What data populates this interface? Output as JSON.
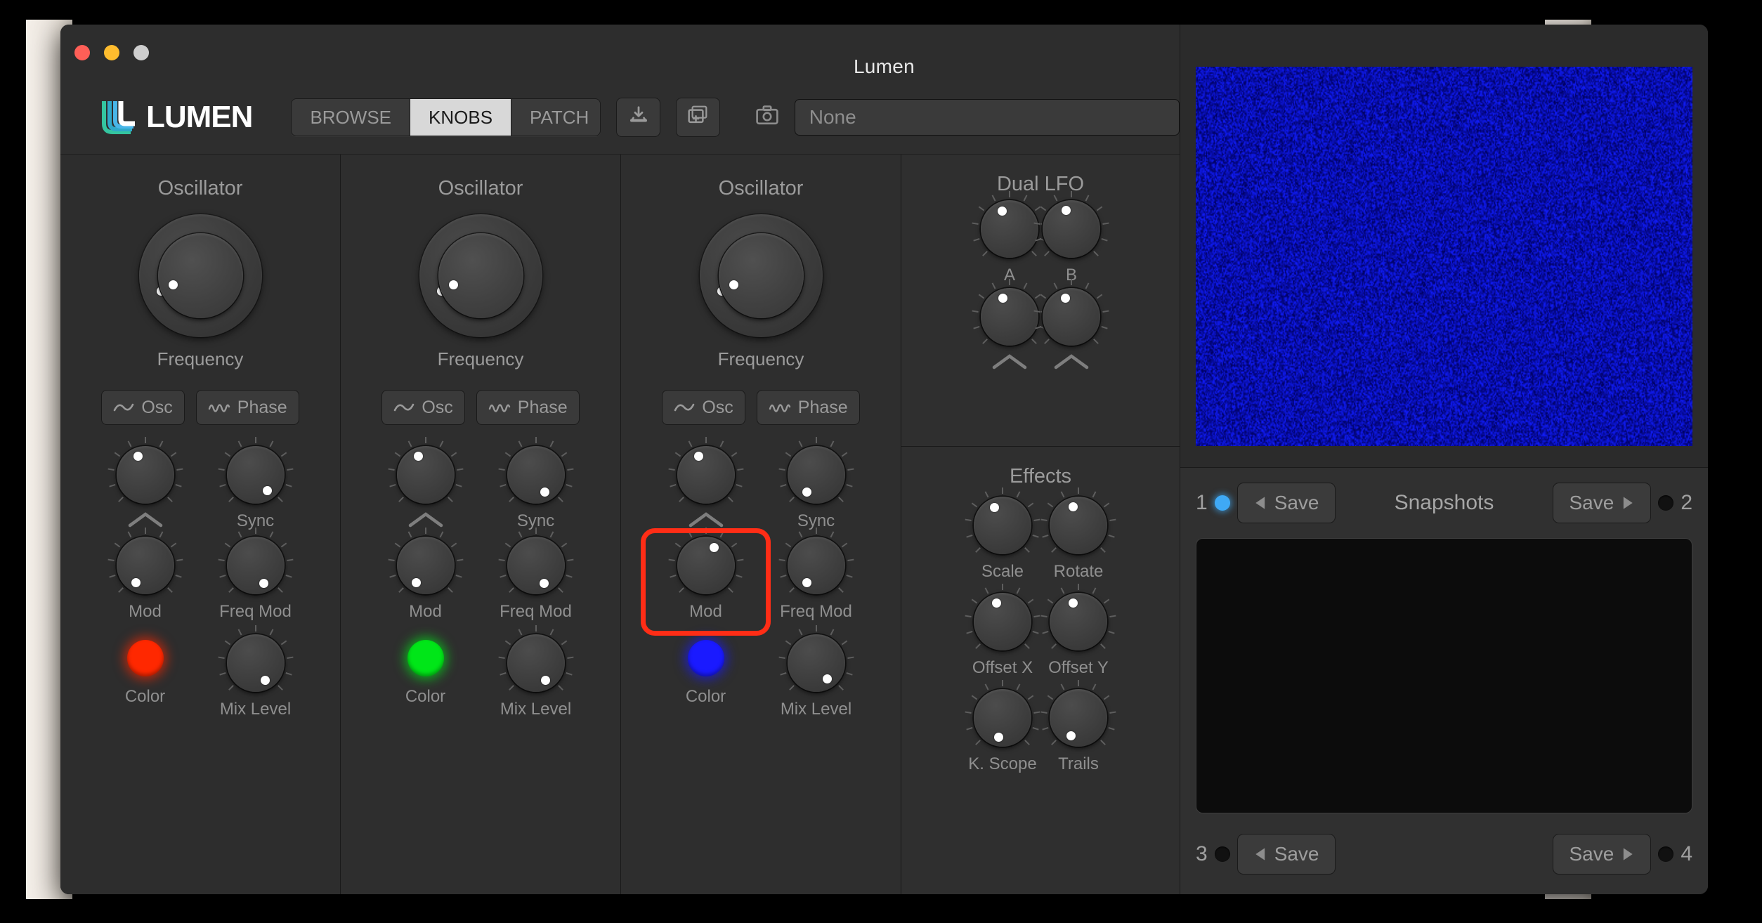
{
  "window": {
    "title": "Lumen",
    "traffic_lights": [
      "close-red",
      "minimize-yellow",
      "zoom-gray"
    ]
  },
  "toolbar": {
    "logo_text": "LUMEN",
    "tabs": [
      {
        "label": "BROWSE",
        "active": false
      },
      {
        "label": "KNOBS",
        "active": true
      },
      {
        "label": "PATCH",
        "active": false
      }
    ],
    "icon_buttons": [
      {
        "name": "download-icon",
        "glyph": "download"
      },
      {
        "name": "add-layer-icon",
        "glyph": "add-layer"
      }
    ],
    "camera_icon": "camera-icon",
    "patch_name_field": {
      "value": "None",
      "placeholder": "None"
    }
  },
  "oscillators": [
    {
      "title": "Oscillator",
      "frequency_label": "Frequency",
      "freq_outer_angle": 248,
      "freq_inner_angle": 250,
      "wave_buttons": [
        {
          "label": "Osc",
          "icon": "sine-wave-icon"
        },
        {
          "label": "Phase",
          "icon": "double-wave-icon"
        }
      ],
      "knobs": [
        {
          "label": "",
          "icon": "chevron-up-icon",
          "angle": 340,
          "name": "shape-knob"
        },
        {
          "label": "Sync",
          "angle": 143,
          "name": "sync-knob"
        },
        {
          "label": "Mod",
          "angle": 207,
          "name": "mod-knob"
        },
        {
          "label": "Freq Mod",
          "angle": 155,
          "name": "freq-mod-knob"
        }
      ],
      "color_label": "Color",
      "color": "#ff2800",
      "mix_label": "Mix Level",
      "mix_angle": 150
    },
    {
      "title": "Oscillator",
      "frequency_label": "Frequency",
      "freq_outer_angle": 248,
      "freq_inner_angle": 250,
      "wave_buttons": [
        {
          "label": "Osc",
          "icon": "sine-wave-icon"
        },
        {
          "label": "Phase",
          "icon": "double-wave-icon"
        }
      ],
      "knobs": [
        {
          "label": "",
          "icon": "chevron-up-icon",
          "angle": 340,
          "name": "shape-knob"
        },
        {
          "label": "Sync",
          "angle": 152,
          "name": "sync-knob"
        },
        {
          "label": "Mod",
          "angle": 207,
          "name": "mod-knob"
        },
        {
          "label": "Freq Mod",
          "angle": 155,
          "name": "freq-mod-knob"
        }
      ],
      "color_label": "Color",
      "color": "#00e618",
      "mix_label": "Mix Level",
      "mix_angle": 150
    },
    {
      "title": "Oscillator",
      "frequency_label": "Frequency",
      "freq_outer_angle": 248,
      "freq_inner_angle": 250,
      "wave_buttons": [
        {
          "label": "Osc",
          "icon": "sine-wave-icon"
        },
        {
          "label": "Phase",
          "icon": "double-wave-icon"
        }
      ],
      "knobs": [
        {
          "label": "",
          "icon": "chevron-up-icon",
          "angle": 340,
          "name": "shape-knob"
        },
        {
          "label": "Sync",
          "angle": 207,
          "name": "sync-knob"
        },
        {
          "label": "Mod",
          "angle": 25,
          "name": "mod-knob",
          "highlighted": true
        },
        {
          "label": "Freq Mod",
          "angle": 207,
          "name": "freq-mod-knob"
        }
      ],
      "color_label": "Color",
      "color": "#1a1aff",
      "mix_label": "Mix Level",
      "mix_angle": 145
    }
  ],
  "dual_lfo": {
    "title": "Dual LFO",
    "knobs": [
      {
        "label": "A",
        "angle": 338,
        "name": "lfo-a-rate-knob"
      },
      {
        "label": "B",
        "angle": 345,
        "name": "lfo-b-rate-knob"
      },
      {
        "label": "",
        "icon": "chevron-up-icon",
        "angle": 340,
        "name": "lfo-a-shape-knob"
      },
      {
        "label": "",
        "icon": "chevron-up-icon",
        "angle": 343,
        "name": "lfo-b-shape-knob"
      }
    ]
  },
  "effects": {
    "title": "Effects",
    "knobs": [
      {
        "label": "Scale",
        "angle": 335,
        "name": "scale-knob"
      },
      {
        "label": "Rotate",
        "angle": 345,
        "name": "rotate-knob"
      },
      {
        "label": "Offset X",
        "angle": 342,
        "name": "offset-x-knob"
      },
      {
        "label": "Offset Y",
        "angle": 345,
        "name": "offset-y-knob"
      },
      {
        "label": "K. Scope",
        "angle": 192,
        "name": "kaleidoscope-knob"
      },
      {
        "label": "Trails",
        "angle": 203,
        "name": "trails-knob"
      }
    ]
  },
  "visualizer": {
    "name": "output-visualizer",
    "dominant_color": "#0b18d2"
  },
  "snapshots": {
    "title": "Snapshots",
    "slots": [
      {
        "number": "1",
        "led": "on",
        "save_label": "Save",
        "arrow": "left"
      },
      {
        "number": "2",
        "led": "off",
        "save_label": "Save",
        "arrow": "right"
      },
      {
        "number": "3",
        "led": "off",
        "save_label": "Save",
        "arrow": "left"
      },
      {
        "number": "4",
        "led": "off",
        "save_label": "Save",
        "arrow": "right"
      }
    ]
  },
  "annotation": {
    "highlight_color": "#ff2d16",
    "target": "Mod knob of third oscillator"
  }
}
